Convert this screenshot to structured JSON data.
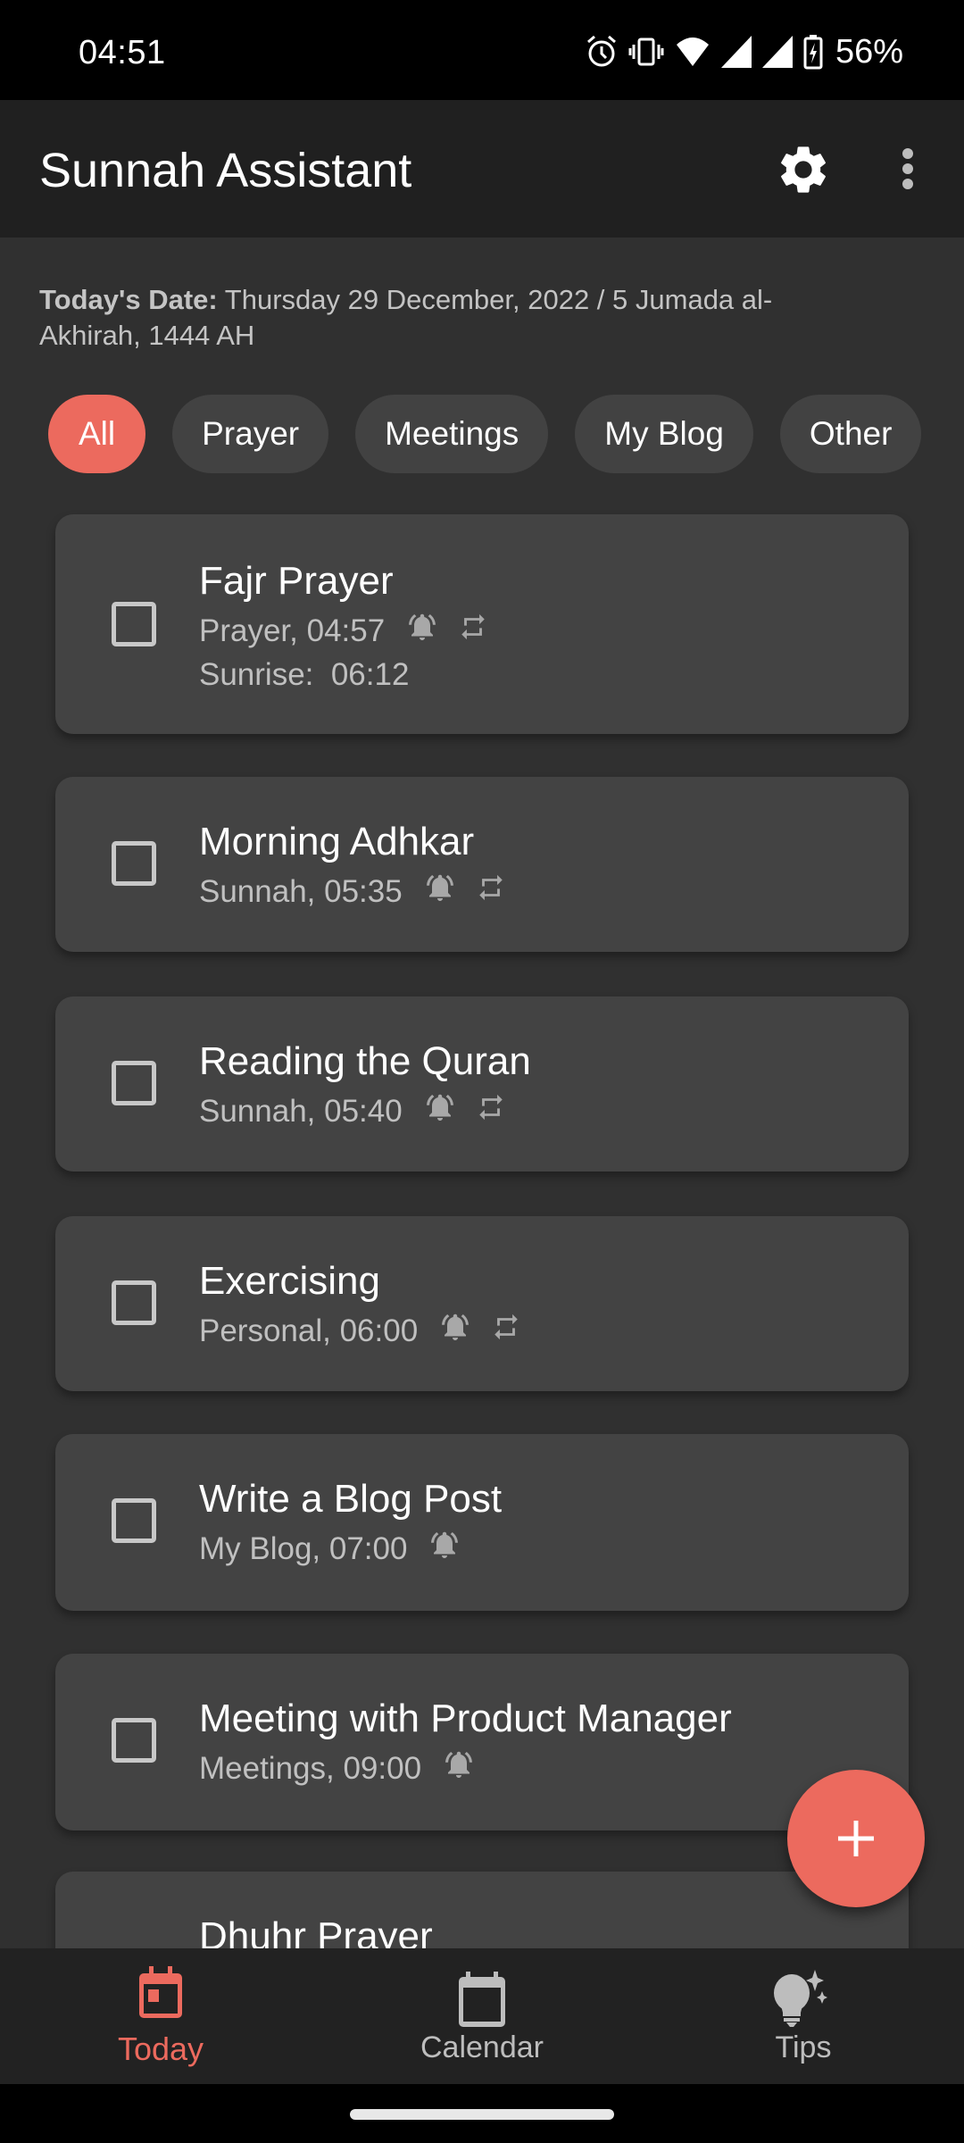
{
  "status_bar": {
    "time": "04:51",
    "icons": [
      "alarm-icon",
      "vibrate-icon",
      "wifi-icon",
      "signal-icon",
      "signal-icon",
      "battery-charging-icon"
    ],
    "battery": "56%"
  },
  "app_bar": {
    "title": "Sunnah Assistant",
    "actions": [
      "gear-icon",
      "more-vert-icon"
    ]
  },
  "date": {
    "label": "Today's Date:",
    "value": " Thursday 29 December, 2022 / 5 Jumada al-Akhirah, 1444 AH"
  },
  "filters": {
    "selected": "All",
    "chips": [
      {
        "label": "All",
        "active": true
      },
      {
        "label": "Prayer",
        "active": false
      },
      {
        "label": "Meetings",
        "active": false
      },
      {
        "label": "My Blog",
        "active": false
      },
      {
        "label": "Other",
        "active": false
      }
    ]
  },
  "tasks": [
    {
      "title": "Fajr Prayer",
      "subtitle": "Prayer, 04:57",
      "reminder": true,
      "repeat": true,
      "extra": "Sunrise:  06:12",
      "checked": false
    },
    {
      "title": "Morning Adhkar",
      "subtitle": "Sunnah, 05:35",
      "reminder": true,
      "repeat": true,
      "checked": false
    },
    {
      "title": "Reading the Quran",
      "subtitle": "Sunnah, 05:40",
      "reminder": true,
      "repeat": true,
      "checked": false
    },
    {
      "title": "Exercising",
      "subtitle": "Personal, 06:00",
      "reminder": true,
      "repeat": true,
      "checked": false
    },
    {
      "title": "Write a Blog Post",
      "subtitle": "My Blog, 07:00",
      "reminder": true,
      "repeat": false,
      "checked": false
    },
    {
      "title": "Meeting with Product Manager",
      "subtitle": "Meetings, 09:00",
      "reminder": true,
      "repeat": false,
      "checked": false
    },
    {
      "title": "Dhuhr Prayer",
      "partial": true
    }
  ],
  "fab": {
    "icon": "plus-icon",
    "action": "add-task"
  },
  "bottom_nav": {
    "items": [
      {
        "label": "Today",
        "icon": "today-icon",
        "active": true
      },
      {
        "label": "Calendar",
        "icon": "calendar-icon",
        "active": false
      },
      {
        "label": "Tips",
        "icon": "tips-lightbulb-icon",
        "active": false
      }
    ]
  },
  "colors": {
    "accent": "#ec6a5e",
    "background": "#303030",
    "card": "#434343",
    "app_bar": "#202020",
    "nav_bar": "#222222"
  }
}
